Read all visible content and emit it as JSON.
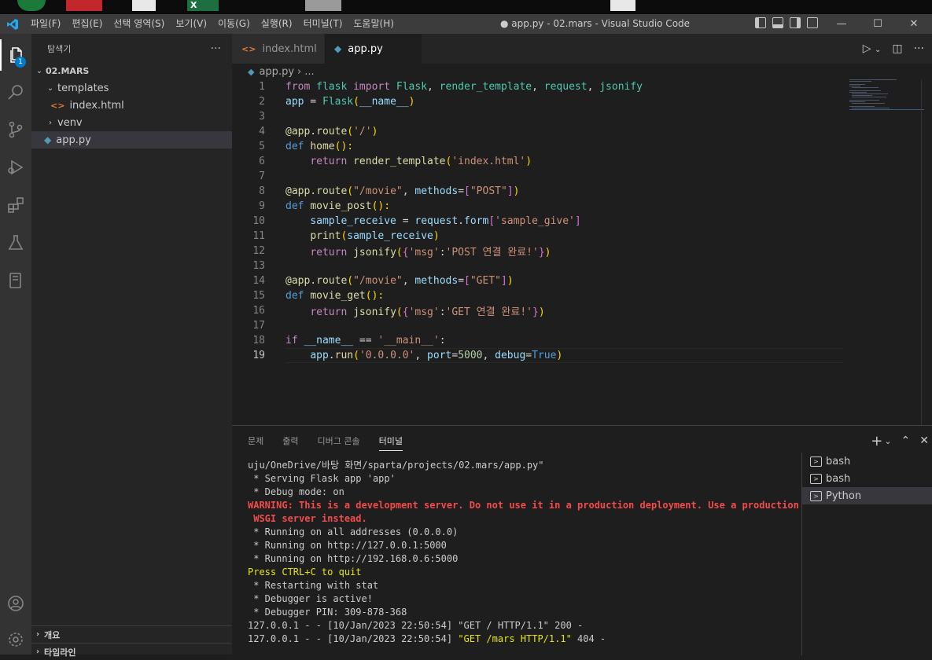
{
  "window": {
    "title": "● app.py - 02.mars - Visual Studio Code"
  },
  "menu": [
    "파일(F)",
    "편집(E)",
    "선택 영역(S)",
    "보기(V)",
    "이동(G)",
    "실행(R)",
    "터미널(T)",
    "도움말(H)"
  ],
  "window_controls": {
    "minimize": "—",
    "maximize": "☐",
    "close": "✕"
  },
  "activity": {
    "explorer_badge": "1"
  },
  "explorer": {
    "title": "탐색기",
    "more": "···",
    "root": "02.MARS",
    "items": [
      "templates",
      "index.html",
      "venv",
      "app.py"
    ],
    "footer": [
      "개요",
      "타임라인"
    ]
  },
  "tabs": [
    {
      "label": "index.html",
      "icon": "html-icon"
    },
    {
      "label": "app.py",
      "icon": "python-icon",
      "active": true,
      "modified": true
    }
  ],
  "breadcrumb": {
    "file": "app.py",
    "sep": "›",
    "more": "..."
  },
  "code": {
    "lines": [
      [
        [
          "from",
          "kc"
        ],
        [
          " ",
          "w"
        ],
        [
          "flask",
          "c"
        ],
        [
          " ",
          "w"
        ],
        [
          "import",
          "kc"
        ],
        [
          " ",
          "w"
        ],
        [
          "Flask",
          "c"
        ],
        [
          ", ",
          "w"
        ],
        [
          "render_template",
          "c"
        ],
        [
          ", ",
          "w"
        ],
        [
          "request",
          "c"
        ],
        [
          ", ",
          "w"
        ],
        [
          "jsonify",
          "c"
        ]
      ],
      [
        [
          "app",
          "v"
        ],
        [
          " = ",
          "w"
        ],
        [
          "Flask",
          "c"
        ],
        [
          "(",
          "p"
        ],
        [
          "__name__",
          "v"
        ],
        [
          ")",
          "p"
        ]
      ],
      [],
      [
        [
          "@app.route",
          "f"
        ],
        [
          "(",
          "p"
        ],
        [
          "'/'",
          "s"
        ],
        [
          ")",
          "p"
        ]
      ],
      [
        [
          "def",
          "k"
        ],
        [
          " ",
          "w"
        ],
        [
          "home",
          "f"
        ],
        [
          "():",
          "p"
        ]
      ],
      [
        [
          "    ",
          "w"
        ],
        [
          "return",
          "kc"
        ],
        [
          " ",
          "w"
        ],
        [
          "render_template",
          "f"
        ],
        [
          "(",
          "p"
        ],
        [
          "'index.html'",
          "s"
        ],
        [
          ")",
          "p"
        ]
      ],
      [],
      [
        [
          "@app.route",
          "f"
        ],
        [
          "(",
          "p"
        ],
        [
          "\"/movie\"",
          "s"
        ],
        [
          ", ",
          "w"
        ],
        [
          "methods",
          "v"
        ],
        [
          "=",
          "w"
        ],
        [
          "[",
          "br"
        ],
        [
          "\"POST\"",
          "s"
        ],
        [
          "]",
          "br"
        ],
        [
          ")",
          "p"
        ]
      ],
      [
        [
          "def",
          "k"
        ],
        [
          " ",
          "w"
        ],
        [
          "movie_post",
          "f"
        ],
        [
          "():",
          "p"
        ]
      ],
      [
        [
          "    ",
          "w"
        ],
        [
          "sample_receive",
          "v"
        ],
        [
          " = ",
          "w"
        ],
        [
          "request",
          "v"
        ],
        [
          ".",
          "w"
        ],
        [
          "form",
          "v"
        ],
        [
          "[",
          "br"
        ],
        [
          "'sample_give'",
          "s"
        ],
        [
          "]",
          "br"
        ]
      ],
      [
        [
          "    ",
          "w"
        ],
        [
          "print",
          "f"
        ],
        [
          "(",
          "p"
        ],
        [
          "sample_receive",
          "v"
        ],
        [
          ")",
          "p"
        ]
      ],
      [
        [
          "    ",
          "w"
        ],
        [
          "return",
          "kc"
        ],
        [
          " ",
          "w"
        ],
        [
          "jsonify",
          "f"
        ],
        [
          "(",
          "p"
        ],
        [
          "{",
          "br"
        ],
        [
          "'msg'",
          "s"
        ],
        [
          ":",
          "w"
        ],
        [
          "'POST 연결 완료!'",
          "s"
        ],
        [
          "}",
          "br"
        ],
        [
          ")",
          "p"
        ]
      ],
      [],
      [
        [
          "@app.route",
          "f"
        ],
        [
          "(",
          "p"
        ],
        [
          "\"/movie\"",
          "s"
        ],
        [
          ", ",
          "w"
        ],
        [
          "methods",
          "v"
        ],
        [
          "=",
          "w"
        ],
        [
          "[",
          "br"
        ],
        [
          "\"GET\"",
          "s"
        ],
        [
          "]",
          "br"
        ],
        [
          ")",
          "p"
        ]
      ],
      [
        [
          "def",
          "k"
        ],
        [
          " ",
          "w"
        ],
        [
          "movie_get",
          "f"
        ],
        [
          "():",
          "p"
        ]
      ],
      [
        [
          "    ",
          "w"
        ],
        [
          "return",
          "kc"
        ],
        [
          " ",
          "w"
        ],
        [
          "jsonify",
          "f"
        ],
        [
          "(",
          "p"
        ],
        [
          "{",
          "br"
        ],
        [
          "'msg'",
          "s"
        ],
        [
          ":",
          "w"
        ],
        [
          "'GET 연결 완료!'",
          "s"
        ],
        [
          "}",
          "br"
        ],
        [
          ")",
          "p"
        ]
      ],
      [],
      [
        [
          "if",
          "kc"
        ],
        [
          " ",
          "w"
        ],
        [
          "__name__",
          "v"
        ],
        [
          " == ",
          "w"
        ],
        [
          "'__main__'",
          "s"
        ],
        [
          ":",
          "w"
        ]
      ],
      [
        [
          "    ",
          "w"
        ],
        [
          "app",
          "v"
        ],
        [
          ".",
          "w"
        ],
        [
          "run",
          "f"
        ],
        [
          "(",
          "p"
        ],
        [
          "'0.0.0.0'",
          "s"
        ],
        [
          ", ",
          "w"
        ],
        [
          "port",
          "v"
        ],
        [
          "=",
          "w"
        ],
        [
          "5000",
          "n"
        ],
        [
          ", ",
          "w"
        ],
        [
          "debug",
          "v"
        ],
        [
          "=",
          "w"
        ],
        [
          "True",
          "k"
        ],
        [
          ")",
          "p"
        ]
      ]
    ],
    "current_line": 19
  },
  "panel": {
    "tabs": [
      "문제",
      "출력",
      "디버그 콘솔",
      "터미널"
    ],
    "active_tab": "터미널",
    "controls": {
      "add": "+",
      "dropdown": "⌄",
      "maximize": "⌃",
      "close": "✕"
    },
    "terminal_lines": [
      {
        "t": "uju/OneDrive/바탕 화면/sparta/projects/02.mars/app.py\"",
        "c": ""
      },
      {
        "t": " * Serving Flask app 'app'",
        "c": ""
      },
      {
        "t": " * Debug mode: on",
        "c": ""
      },
      {
        "t": "WARNING: This is a development server. Do not use it in a production deployment. Use a production",
        "c": "tred"
      },
      {
        "t": " WSGI server instead.",
        "c": "tred"
      },
      {
        "t": " * Running on all addresses (0.0.0.0)",
        "c": ""
      },
      {
        "t": " * Running on http://127.0.0.1:5000",
        "c": ""
      },
      {
        "t": " * Running on http://192.168.0.6:5000",
        "c": ""
      },
      {
        "t": "Press CTRL+C to quit",
        "c": "tyel"
      },
      {
        "t": " * Restarting with stat",
        "c": ""
      },
      {
        "t": " * Debugger is active!",
        "c": ""
      },
      {
        "t": " * Debugger PIN: 309-878-368",
        "c": ""
      },
      {
        "t": "127.0.0.1 - - [10/Jan/2023 22:50:54] \"GET / HTTP/1.1\" 200 -",
        "c": ""
      },
      {
        "t": "127.0.0.1 - - [10/Jan/2023 22:50:54] \"GET /mars HTTP/1.1\" 404 -",
        "c": "",
        "hl": "\"GET /mars HTTP/1.1\""
      }
    ],
    "terminals": [
      {
        "label": "bash"
      },
      {
        "label": "bash"
      },
      {
        "label": "Python",
        "selected": true
      }
    ]
  }
}
